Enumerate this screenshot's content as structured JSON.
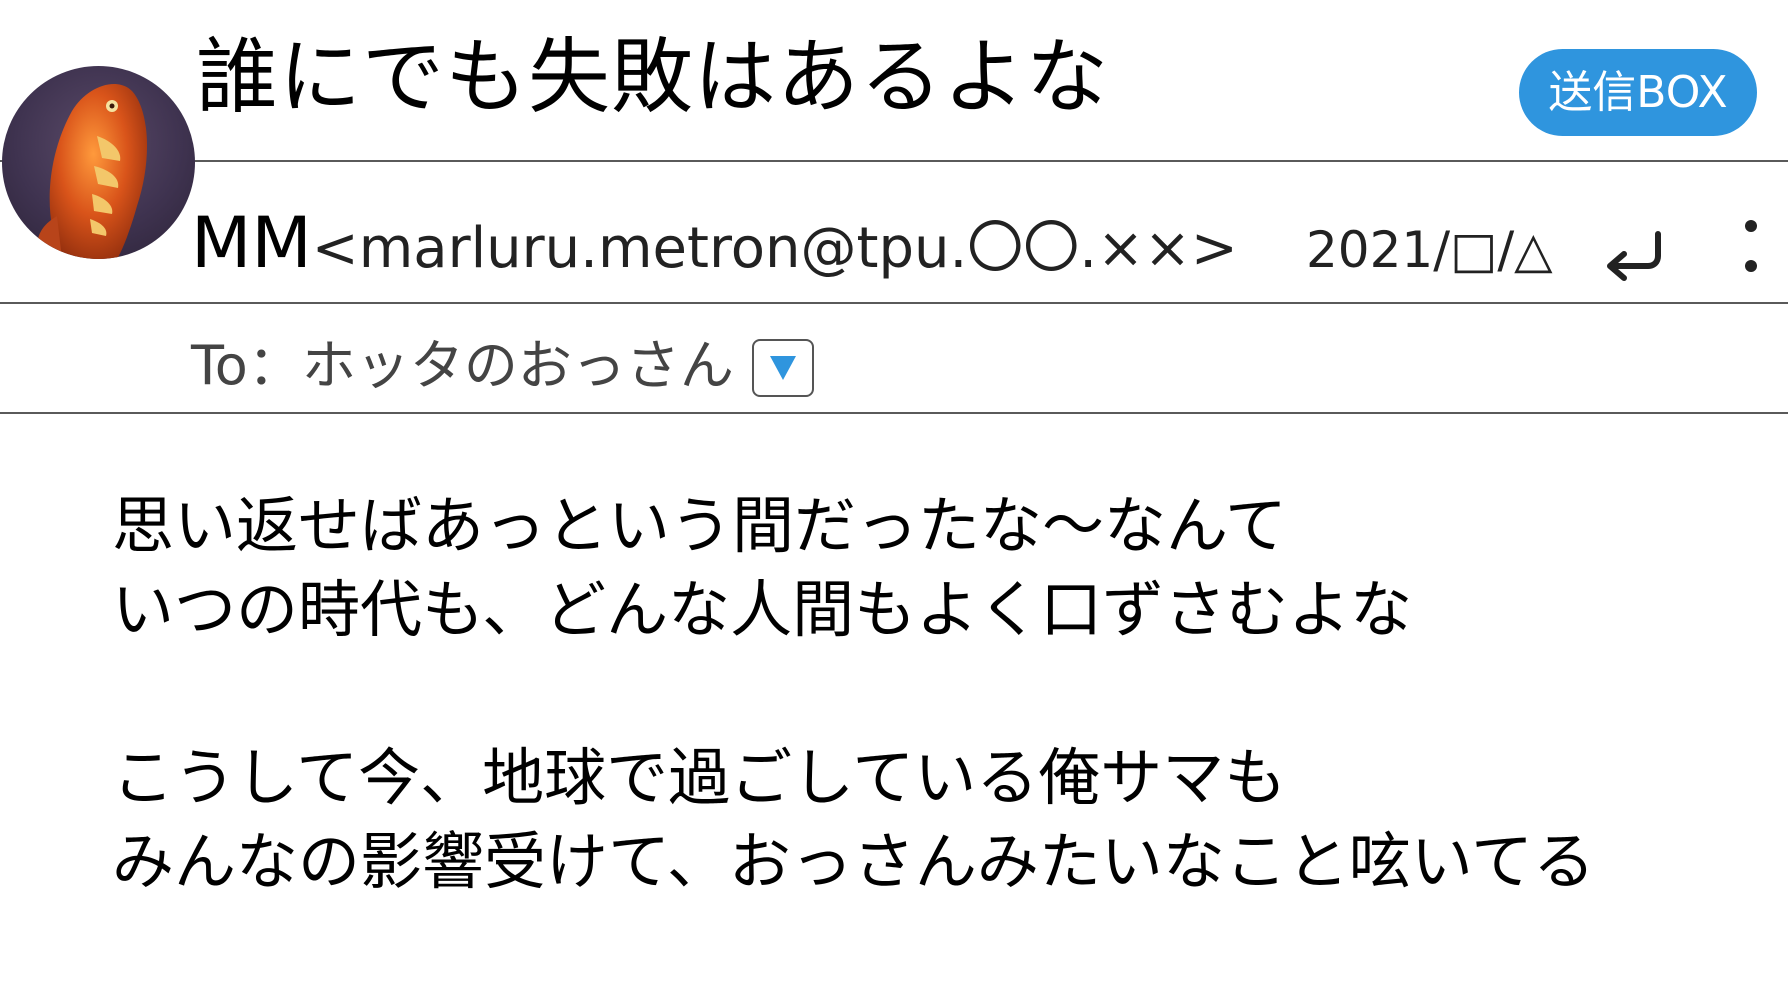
{
  "header": {
    "subject": "誰にでも失敗はあるよな",
    "send_box_label": "送信BOX"
  },
  "sender": {
    "name": "MM",
    "email": "<marluru.metron@tpu.〇〇.××>",
    "date": "2021/□/△",
    "avatar_icon": "avatar-creature-icon"
  },
  "recipient": {
    "to_label": "To：ホッタのおっさん",
    "dropdown_icon": "dropdown-triangle-icon"
  },
  "body": {
    "paragraph1": "思い返せばあっという間だったな～なんて\nいつの時代も、どんな人間もよく口ずさむよな",
    "paragraph2": "こうして今、地球で過ごしている俺サマも\nみんなの影響受けて、おっさんみたいなこと呟いてる"
  },
  "colors": {
    "accent": "#2f95de",
    "divider": "#5a5a5a",
    "text": "#000000"
  }
}
